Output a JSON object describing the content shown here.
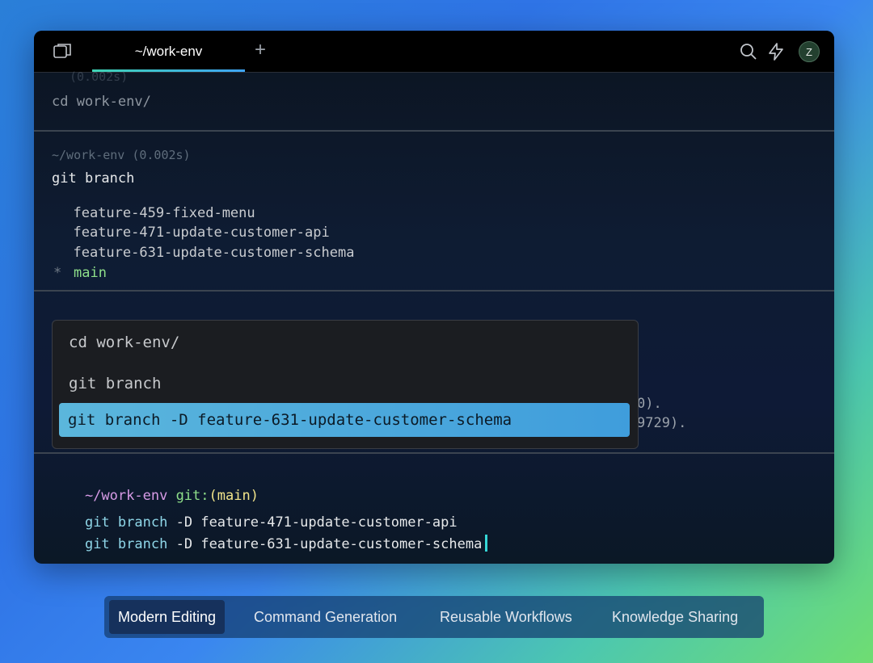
{
  "window": {
    "tab_label": "~/work-env",
    "new_tab_symbol": "+",
    "avatar_letter": "Z"
  },
  "blocks": {
    "top_partial_header": "(0.002s)",
    "top_partial_command": "cd work-env/",
    "branch_header": "~/work-env (0.002s)",
    "branch_command": "git branch",
    "branches": [
      "  feature-459-fixed-menu",
      "  feature-471-update-customer-api",
      "  feature-631-update-customer-schema"
    ],
    "current_branch_marker": "*",
    "current_branch": "main",
    "hidden_output_1": "0).",
    "hidden_output_2": "9729)."
  },
  "history_popup": {
    "items": [
      "cd work-env/",
      "git branch"
    ],
    "selected": "git branch -D feature-631-update-customer-schema"
  },
  "prompt": {
    "path": "~/work-env",
    "git_label": "git:",
    "git_branch_open": "(",
    "git_branch": "main",
    "git_branch_close": ")",
    "lines": [
      {
        "cmd": "git",
        "sub": "branch",
        "flag": "-D",
        "arg": "feature-471-update-customer-api"
      },
      {
        "cmd": "git",
        "sub": "branch",
        "flag": "-D",
        "arg": "feature-631-update-customer-schema"
      }
    ]
  },
  "bottom_nav": {
    "items": [
      "Modern Editing",
      "Command Generation",
      "Reusable Workflows",
      "Knowledge Sharing"
    ],
    "active_index": 0
  },
  "colors": {
    "prompt_path": "#d79be6",
    "git_label": "#8fe08a",
    "git_branch": "#f1e48a",
    "cmd_word": "#8fd6e8",
    "flag": "#e6e8ea",
    "cursor": "#35d6d6",
    "selection": "#4aa6de"
  }
}
